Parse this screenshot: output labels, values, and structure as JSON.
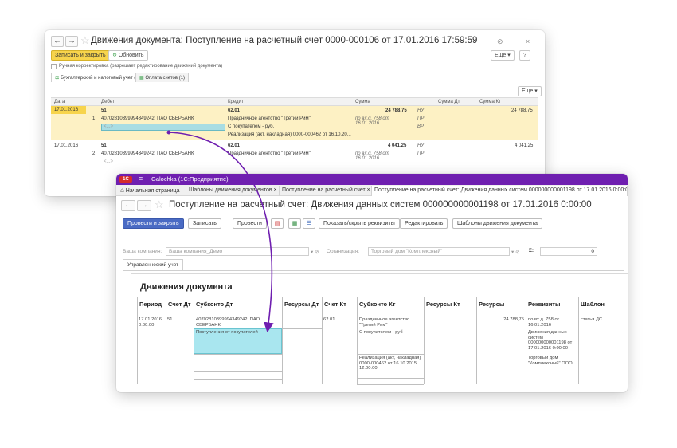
{
  "win1": {
    "title": "Движения документа: Поступление на расчетный счет 0000-000106 от 17.01.2016 17:59:59",
    "link_icon": "⊘",
    "more_dots": "⋮",
    "close": "×",
    "save_close": "Записать и закрыть",
    "refresh": "Обновить",
    "more": "Еще",
    "help": "?",
    "manual_edit": "Ручная корректировка (разрешает редактирование движений документа)",
    "tabs": [
      "Бухгалтерский и налоговый учет (2)",
      "Оплата счетов (1)"
    ],
    "grid_more": "Еще",
    "columns": [
      "Дата",
      "Дебет",
      "Кредит",
      "Сумма",
      "Сумма Дт",
      "Сумма Кт"
    ],
    "rows": [
      {
        "date": "17.01.2016",
        "num": "1",
        "debit_acc": "51",
        "debit_sub1": "40702810399994349242, ПАО СБЕРБАНК",
        "debit_sub2": "<...>",
        "credit_acc": "62.01",
        "credit_sub1": "Праздничное агентство \"Третий Рим\"",
        "credit_sub2": "С покупателем - руб.",
        "credit_sub3": "Реализация (акт, накладная) 0000-000462 от 16.10.20...",
        "amount": "24 788,75",
        "nu": "НУ",
        "pr": "ПР",
        "vr": "ВР",
        "doc": "по вх.д. 758 от 16.01.2016",
        "sum_kt": "24 788,75"
      },
      {
        "date": "17.01.2016",
        "num": "2",
        "debit_acc": "51",
        "debit_sub1": "40702810399994349242, ПАО СБЕРБАНК",
        "debit_sub2": "<...>",
        "credit_acc": "62.01",
        "credit_sub1": "Праздничное агентство \"Третий Рим\"",
        "amount": "4 041,25",
        "nu": "НУ",
        "pr": "ПР",
        "doc": "по вх.д. 758 от 16.01.2016",
        "sum_kt": "4 041,25"
      }
    ]
  },
  "win2": {
    "app_logo": "1С",
    "app_title": "Galochka (1С:Предприятие)",
    "tabs": [
      "Начальная страница",
      "Шаблоны движения документов ×",
      "Поступление на расчетный счет ×",
      "Поступление на расчетный счет: Движения данных систем 000000000001198 от 17.01.2016 0:00:00 ×"
    ],
    "title": "Поступление на расчетный счет: Движения данных систем 000000000001198 от 17.01.2016 0:00:00",
    "toolbar": {
      "post_close": "Провести и закрыть",
      "save": "Записать",
      "post": "Провести",
      "toggle_req": "Показать/скрыть реквизиты",
      "edit": "Редактировать",
      "templates": "Шаблоны движения документа"
    },
    "company_label": "Ваша компания:",
    "company_value": "Ваша компания_Демо",
    "org_label": "Организация:",
    "org_value": "Торговый дом \"Комплексный\"",
    "sigma": "Σ:",
    "sigma_value": "0",
    "tab_mgmt": "Управленческий учет",
    "sheet_title": "Движения документа",
    "columns": [
      "Период",
      "Счет Дт",
      "Субконто Дт",
      "Ресурсы Дт",
      "Счет Кт",
      "Субконто Кт",
      "Ресурсы Кт",
      "Ресурсы",
      "Реквизиты",
      "Шаблон"
    ],
    "row": {
      "period": "17.01.2016 0:00:00",
      "acc_dt": "51",
      "sub_dt_1": "40702810399994349242, ПАО СБЕРБАНК",
      "sub_dt_2": "Поступления от покупателей",
      "acc_kt": "62.01",
      "sub_kt_1": "Праздничное агентство \"Третий Рим\"",
      "sub_kt_2": "С покупателем - руб",
      "sub_kt_3": "Реализация (акт, накладная) 0000-000462 от 16.10.2015 12:00:00",
      "resources": "24 788,75",
      "req_1": "по вх.д. 758 от 16.01.2016",
      "req_2": "Движения данных систем 000000000001198 от 17.01.2016 0:00:00",
      "req_3": "Торговый дом \"Комплексный\" ООО",
      "template": "статья ДС"
    }
  },
  "colors": {
    "accent": "#6f1fb0",
    "yellow": "#f7d44c",
    "selection": "#a9e6ef",
    "primary_button": "#4a6bc4"
  }
}
